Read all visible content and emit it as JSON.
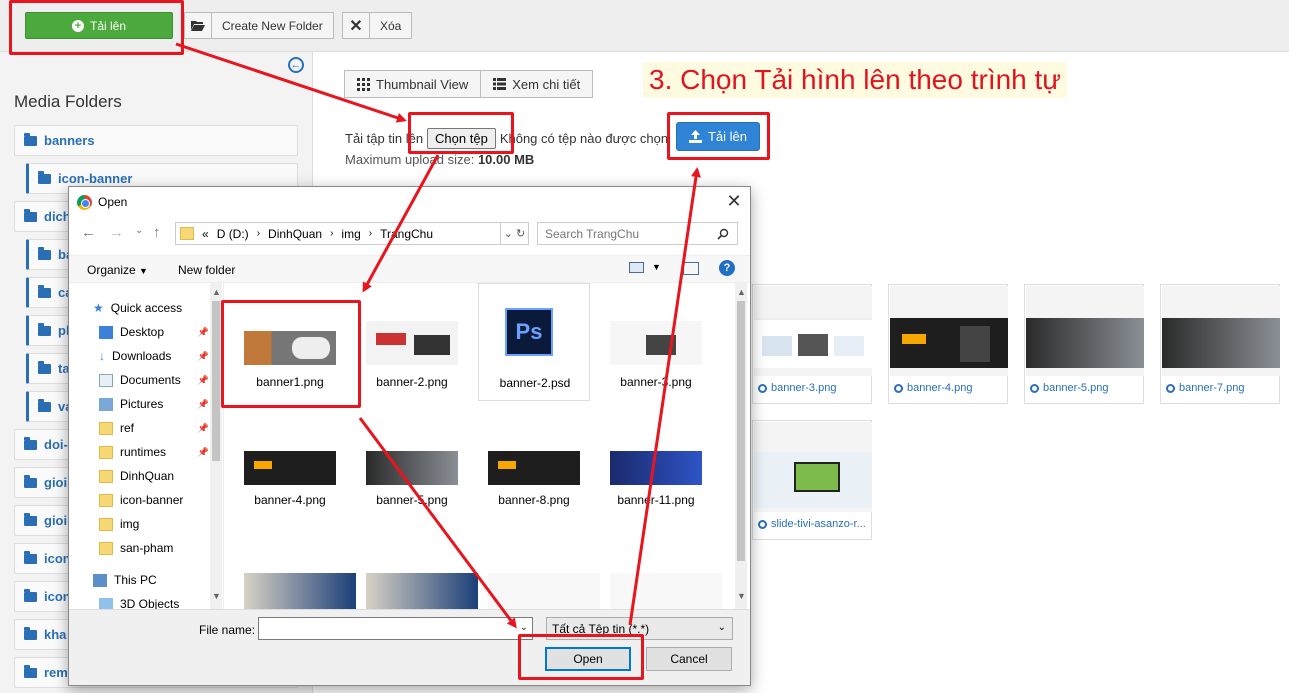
{
  "toolbar": {
    "upload_label": "Tải lên",
    "create_folder_label": "Create New Folder",
    "delete_label": "Xóa"
  },
  "sidebar": {
    "title": "Media Folders",
    "folders": [
      {
        "label": "banners"
      },
      {
        "label": "icon-banner"
      },
      {
        "label": "dich"
      },
      {
        "label": "ba"
      },
      {
        "label": "ca"
      },
      {
        "label": "ph"
      },
      {
        "label": "ta"
      },
      {
        "label": "va"
      },
      {
        "label": "doi-"
      },
      {
        "label": "gioi"
      },
      {
        "label": "gioi"
      },
      {
        "label": "icon"
      },
      {
        "label": "icon"
      },
      {
        "label": "kha"
      },
      {
        "label": "rem"
      }
    ]
  },
  "main": {
    "view_thumbnail": "Thumbnail View",
    "view_detail": "Xem chi tiết",
    "annotation": "3. Chọn Tải hình lên theo trình tự",
    "upload_prefix": "Tải tập tin lên",
    "choose_file": "Chọn tệp",
    "no_file": "Không có tệp nào được chọn",
    "upload_button": "Tải lên",
    "max_size_label": "Maximum upload size:",
    "max_size_value": "10.00 MB",
    "thumbnails": [
      {
        "name": "banner-3.png"
      },
      {
        "name": "banner-4.png"
      },
      {
        "name": "banner-5.png"
      },
      {
        "name": "banner-7.png"
      },
      {
        "name": "slide-tivi-asanzo-r..."
      }
    ]
  },
  "dialog": {
    "title": "Open",
    "path": [
      "D (D:)",
      "DinhQuan",
      "img",
      "TrangChu"
    ],
    "search_placeholder": "Search TrangChu",
    "organize": "Organize",
    "new_folder": "New folder",
    "nav": [
      {
        "label": "Quick access"
      },
      {
        "label": "Desktop"
      },
      {
        "label": "Downloads"
      },
      {
        "label": "Documents"
      },
      {
        "label": "Pictures"
      },
      {
        "label": "ref"
      },
      {
        "label": "runtimes"
      },
      {
        "label": "DinhQuan"
      },
      {
        "label": "icon-banner"
      },
      {
        "label": "img"
      },
      {
        "label": "san-pham"
      },
      {
        "label": "This PC"
      },
      {
        "label": "3D Objects"
      }
    ],
    "files": [
      {
        "name": "banner1.png"
      },
      {
        "name": "banner-2.png"
      },
      {
        "name": "banner-2.psd"
      },
      {
        "name": "banner-3.png"
      },
      {
        "name": "banner-4.png"
      },
      {
        "name": "banner-5.png"
      },
      {
        "name": "banner-8.png"
      },
      {
        "name": "banner-11.png"
      }
    ],
    "file_name_label": "File name:",
    "file_type": "Tất cả Tệp tin (*.*)",
    "open_button": "Open",
    "cancel_button": "Cancel",
    "psd_label": "Ps"
  },
  "colors": {
    "accent_blue": "#2a6fb6",
    "upload_green": "#4caa3c",
    "annotation_red": "#e8141e"
  }
}
